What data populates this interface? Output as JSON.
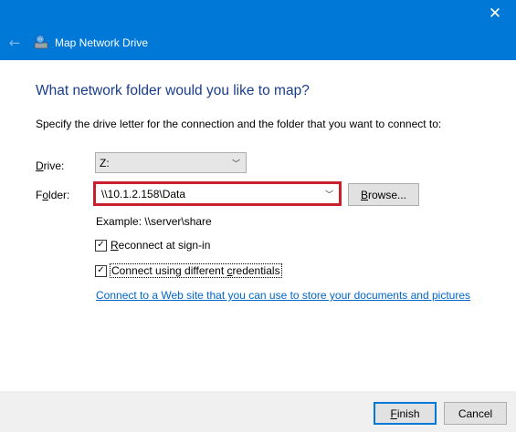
{
  "window": {
    "title": "Map Network Drive",
    "close_glyph": "✕",
    "back_glyph": "←"
  },
  "main": {
    "heading": "What network folder would you like to map?",
    "instruction": "Specify the drive letter for the connection and the folder that you want to connect to:"
  },
  "drive": {
    "label_accel": "D",
    "label_rest": "rive:",
    "value": "Z:"
  },
  "folder": {
    "label_pre": "F",
    "label_accel": "o",
    "label_rest": "lder:",
    "value": "\\\\10.1.2.158\\Data",
    "highlight_color": "#c8202c"
  },
  "browse": {
    "label_accel": "B",
    "label_rest": "rowse..."
  },
  "example_text": "Example: \\\\server\\share",
  "options": {
    "reconnect": {
      "checked": true,
      "label_accel": "R",
      "label_rest": "econnect at sign-in"
    },
    "credentials": {
      "checked": true,
      "label_pre": "Connect using different ",
      "label_accel": "c",
      "label_rest": "redentials"
    }
  },
  "link_text": "Connect to a Web site that you can use to store your documents and pictures",
  "footer": {
    "finish_accel": "F",
    "finish_rest": "inish",
    "cancel_label": "Cancel"
  },
  "colors": {
    "titlebar": "#0078d7",
    "heading": "#1a3c8c",
    "link": "#0066cc"
  }
}
